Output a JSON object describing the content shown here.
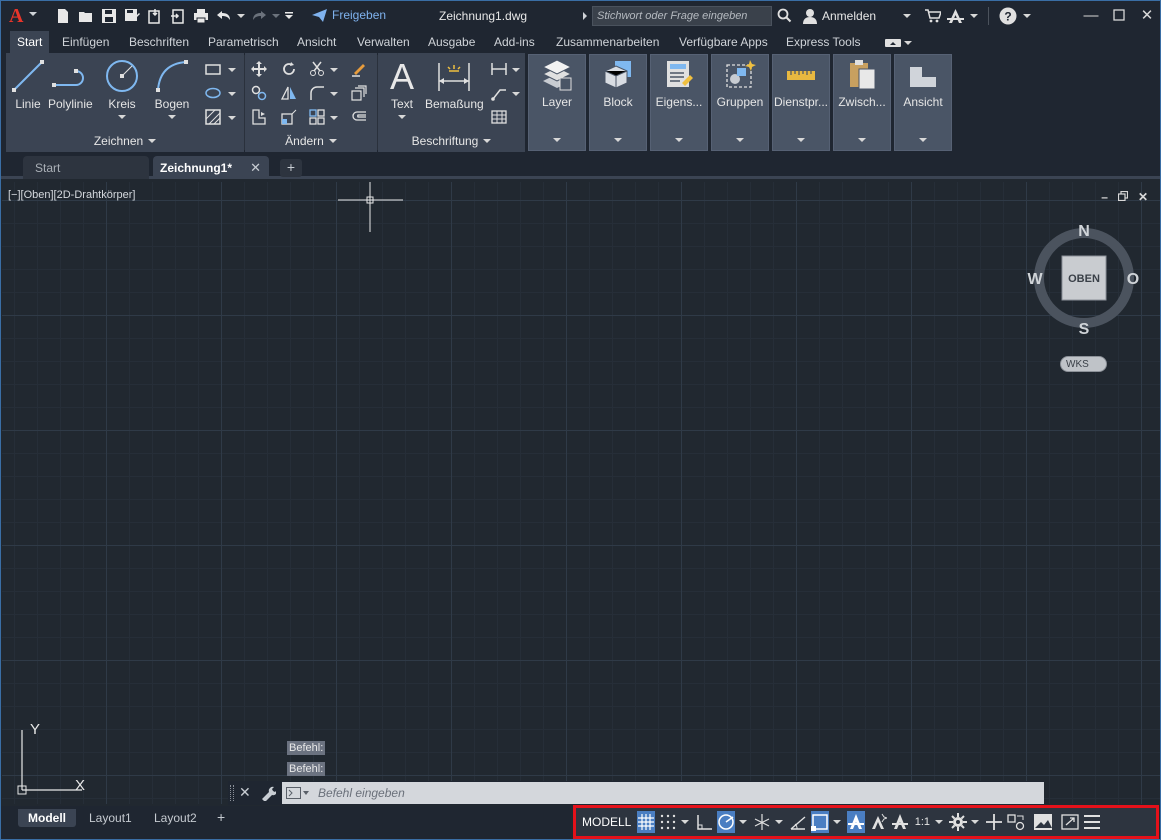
{
  "titlebar": {
    "logo": "A",
    "share_label": "Freigeben",
    "document_title": "Zeichnung1.dwg",
    "search_placeholder": "Stichwort oder Frage eingeben",
    "user_label": "Anmelden"
  },
  "ribbon_tabs": [
    {
      "label": "Start",
      "active": true
    },
    {
      "label": "Einfügen"
    },
    {
      "label": "Beschriften"
    },
    {
      "label": "Parametrisch"
    },
    {
      "label": "Ansicht"
    },
    {
      "label": "Verwalten"
    },
    {
      "label": "Ausgabe"
    },
    {
      "label": "Add-ins"
    },
    {
      "label": "Zusammenarbeiten"
    },
    {
      "label": "Verfügbare Apps"
    },
    {
      "label": "Express Tools"
    }
  ],
  "panels": {
    "zeichnen": {
      "title": "Zeichnen",
      "tools": [
        "Linie",
        "Polylinie",
        "Kreis",
        "Bogen"
      ]
    },
    "aendern": {
      "title": "Ändern"
    },
    "beschriftung": {
      "title": "Beschriftung",
      "tools": [
        "Text",
        "Bemaßung"
      ]
    },
    "groups": [
      "Layer",
      "Block",
      "Eigens...",
      "Gruppen",
      "Dienstpr...",
      "Zwisch...",
      "Ansicht"
    ]
  },
  "doc_tabs": {
    "start": "Start",
    "active": "Zeichnung1*",
    "close": "✕",
    "add": "+"
  },
  "viewport": {
    "label": "[−][Oben][2D-Drahtkörper]",
    "compass": {
      "n": "N",
      "s": "S",
      "w": "W",
      "o": "O",
      "face": "OBEN"
    },
    "wcs": "WKS",
    "ucs_x": "X",
    "ucs_y": "Y"
  },
  "command": {
    "history": [
      "Befehl:",
      "Befehl:"
    ],
    "placeholder": "Befehl eingeben"
  },
  "layout_tabs": [
    "Modell",
    "Layout1",
    "Layout2"
  ],
  "status": {
    "model": "MODELL",
    "scale": "1:1"
  },
  "colors": {
    "accent": "#4a7ec2",
    "highlight_border": "#e5111a",
    "logo": "#e8352a"
  }
}
